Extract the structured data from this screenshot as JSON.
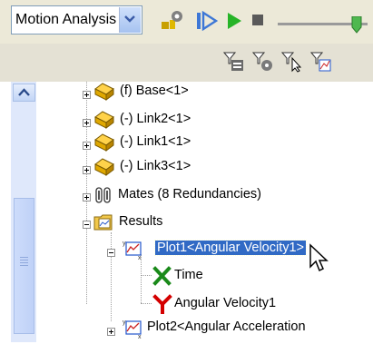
{
  "toolbar": {
    "study_type": "Motion Analysis",
    "icons": [
      "motion-study-properties-icon",
      "calculate-icon",
      "play-icon",
      "play-normal-speed-icon",
      "stop-icon",
      "playback-speed-slider"
    ]
  },
  "filter_toolbar": {
    "icons": [
      "filter-icon",
      "filter-animation-icon",
      "filter-driving-icon",
      "filter-selected-icon",
      "filter-results-icon"
    ]
  },
  "tree": {
    "items": [
      {
        "label": "(f) Base<1>",
        "icon": "part-icon"
      },
      {
        "label": "(-) Link2<1>",
        "icon": "part-icon"
      },
      {
        "label": "(-) Link1<1>",
        "icon": "part-icon"
      },
      {
        "label": "(-) Link3<1>",
        "icon": "part-icon"
      },
      {
        "label": "Mates (8 Redundancies)",
        "icon": "mates-icon"
      },
      {
        "label": "Results",
        "icon": "results-folder-icon"
      },
      {
        "label": "Plot1<Angular Velocity1>",
        "icon": "plot-icon",
        "selected": true
      },
      {
        "label": "Time",
        "icon": "x-axis-icon"
      },
      {
        "label": "Angular Velocity1",
        "icon": "y-axis-icon"
      },
      {
        "label": "Plot2<Angular Acceleration",
        "icon": "plot-icon"
      }
    ]
  },
  "colors": {
    "selection": "#316ac5",
    "toolbar": "#ece9d8",
    "x_axis": "#1a8a1a",
    "y_axis": "#d40000"
  }
}
